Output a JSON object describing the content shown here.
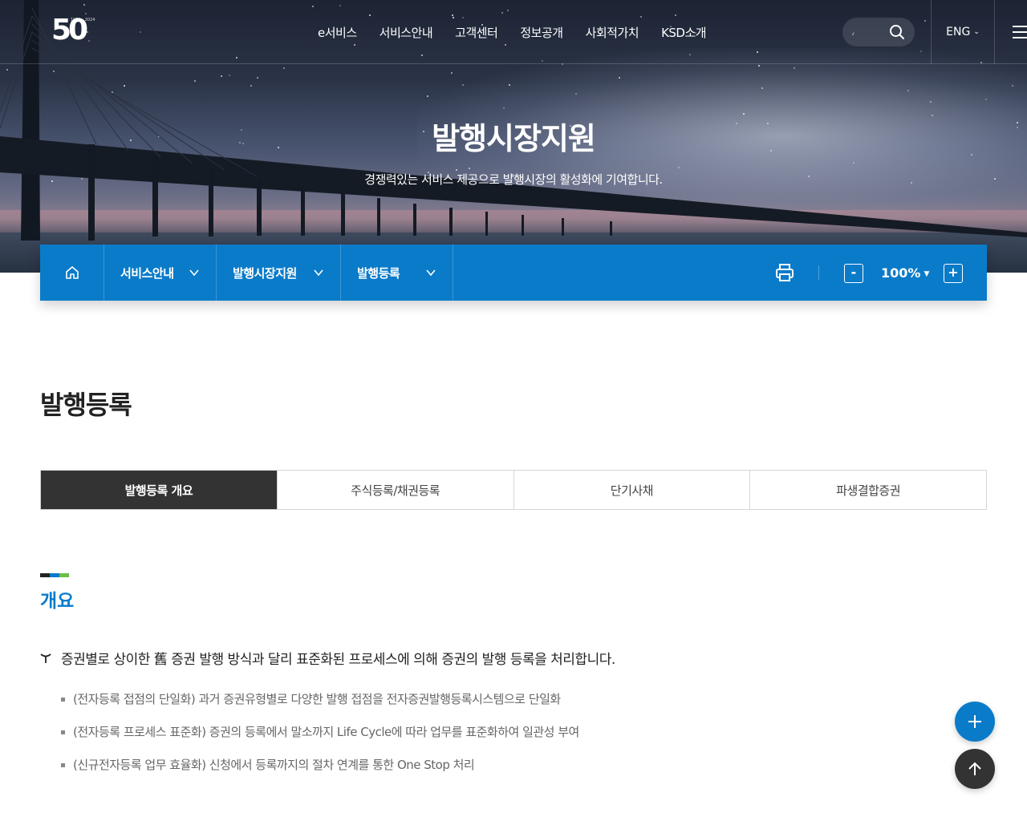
{
  "header": {
    "logo_text": "50",
    "logo_years": "1974 - 2024",
    "nav": [
      "e서비스",
      "서비스안내",
      "고객센터",
      "정보공개",
      "사회적가치",
      "KSD소개"
    ],
    "lang": "ENG"
  },
  "hero": {
    "title": "발행시장지원",
    "subtitle": "경쟁력있는 서비스 제공으로 발행시장의 활성화에 기여합니다."
  },
  "location": {
    "items": [
      "서비스안내",
      "발행시장지원",
      "발행등록"
    ],
    "zoom": "100%",
    "zoom_minus": "-",
    "zoom_plus": "+"
  },
  "page": {
    "title": "발행등록",
    "tabs": [
      "발행등록 개요",
      "주식등록/채권등록",
      "단기사채",
      "파생결합증권"
    ],
    "active_tab": 0
  },
  "section": {
    "bar_colors": [
      "#222222",
      "#0a7bc9",
      "#6cbe45"
    ],
    "title": "개요",
    "lead": "증권별로 상이한 舊 증권 발행 방식과 달리 표준화된 프로세스에 의해 증권의 발행 등록을 처리합니다.",
    "bullets": [
      "(전자등록 접점의 단일화) 과거 증권유형별로 다양한 발행 접점을 전자증권발행등록시스템으로 단일화",
      "(전자등록 프로세스 표준화) 증권의 등록에서 말소까지 Life Cycle에 따라 업무를 표준화하여 일관성 부여",
      "(신규전자등록 업무 효율화) 신청에서 등록까지의 절차 연계를 통한 One Stop 처리"
    ]
  },
  "colors": {
    "brand_blue": "#0a7bc9",
    "dark": "#333333"
  }
}
